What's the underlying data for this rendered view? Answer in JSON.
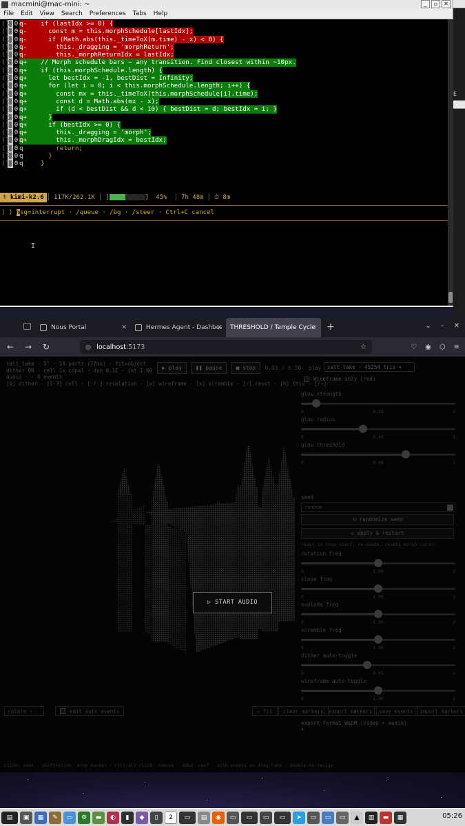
{
  "terminal": {
    "title": "macmini@mac-mini: ~",
    "menu": [
      "File",
      "Edit",
      "View",
      "Search",
      "Preferences",
      "Tabs",
      "Help"
    ],
    "diff": [
      {
        "n": "0",
        "m": "q-",
        "t": "del",
        "c": "  if (lastIdx >= 0) {"
      },
      {
        "n": "0",
        "m": "q-",
        "t": "del",
        "c": "    const m = this.morphSchedule[lastIdx];"
      },
      {
        "n": "0",
        "m": "q-",
        "t": "del",
        "c": "    if (Math.abs(this._timeToX(m.time) - x) < 8) {"
      },
      {
        "n": "0",
        "m": "q-",
        "t": "del",
        "c": "      this._dragging = 'morphReturn';"
      },
      {
        "n": "0",
        "m": "q-",
        "t": "del",
        "c": "      this._morphReturnIdx = lastIdx;"
      },
      {
        "n": "0",
        "m": "q+",
        "t": "add",
        "c": "  // Morph schedule bars — any transition. Find closest within ~10px."
      },
      {
        "n": "0",
        "m": "q+",
        "t": "add",
        "c": "  if (this.morphSchedule.length) {"
      },
      {
        "n": "0",
        "m": "q+",
        "t": "add",
        "c": "    let bestIdx = -1, bestDist = Infinity;"
      },
      {
        "n": "0",
        "m": "q+",
        "t": "add",
        "c": "    for (let i = 0; i < this.morphSchedule.length; i++) {"
      },
      {
        "n": "0",
        "m": "q+",
        "t": "add",
        "c": "      const mx = this._timeToX(this.morphSchedule[i].time);"
      },
      {
        "n": "0",
        "m": "q+",
        "t": "add",
        "c": "      const d = Math.abs(mx - x);"
      },
      {
        "n": "0",
        "m": "q+",
        "t": "add",
        "c": "      if (d < bestDist && d < 10) { bestDist = d; bestIdx = i; }"
      },
      {
        "n": "0",
        "m": "q+",
        "t": "add",
        "c": "    }"
      },
      {
        "n": "0",
        "m": "q+",
        "t": "add",
        "c": "    if (bestIdx >= 0) {"
      },
      {
        "n": "0",
        "m": "q+",
        "t": "add",
        "c": "      this._dragging = 'morph';"
      },
      {
        "n": "0",
        "m": "q+",
        "t": "add",
        "c": "      this._morphDragIdx = bestIdx;"
      },
      {
        "n": "0",
        "m": "q",
        "t": "ctx",
        "c": "      return;"
      },
      {
        "n": "0",
        "m": "q",
        "t": "ctx",
        "c": "    }"
      },
      {
        "n": "0",
        "m": "q",
        "t": "ctx",
        "c": "  }"
      }
    ],
    "gutter_mark": "(`",
    "status": {
      "model": "kimi-k2.6",
      "tokens": "117K/262.1K",
      "progress_text": "45%",
      "progress_fraction": 0.45,
      "elapsed": "7h 48m",
      "timer": "⏱ 8m"
    },
    "prompt_text": "msg=interrupt · /queue · /bg · /steer · Ctrl+C cancel",
    "prompt_glyph": "⟩ ⟩ "
  },
  "browser": {
    "tabs": [
      {
        "label": "Nous Portal",
        "active": false
      },
      {
        "label": "Hermes Agent - Dashboard",
        "active": false
      },
      {
        "label": "THRESHOLD / Temple Cycle",
        "active": true
      }
    ],
    "url_host": "localhost",
    "url_port": ":5173"
  },
  "app": {
    "info_lines": [
      "salt_lake · 5° · 14 parts (77ms) · fit=object",
      "dither ON · cell 1x cdpal · dyn 0.1E · int 1.00",
      "audio · · 0 events",
      "[0] dither · [1-3] cell · [ / ] resolution · [w] wireframe · [s] scramble · [r] reset · [h] this · [/~]"
    ],
    "play_label": "▶ play",
    "pause_label": "❚❚ pause",
    "stop_label": "■ stop",
    "timecode": "0.03 / 6.50",
    "play_select_label": "play",
    "play_select_value": "salt_lake · 45254 tris",
    "wireframe_label": "Wireframe only (red)",
    "sliders_top": [
      {
        "label": "glow strength",
        "value": 0.1,
        "min": "0",
        "mid": "0.10",
        "max": "2"
      },
      {
        "label": "glow radius",
        "value": 0.4,
        "min": "0",
        "mid": "0.40",
        "max": "1"
      },
      {
        "label": "glow threshold",
        "value": 0.68,
        "min": "0",
        "mid": "0.68",
        "max": "1"
      }
    ],
    "seed_heading": "seed",
    "seed_placeholder": "random",
    "randomize_label": "⟲ randomize seed",
    "apply_label": "↻ apply & restart",
    "seed_note": "reset to crop-start, re-seeds, resets morph cursor.",
    "sliders_bottom": [
      {
        "label": "rotation freq",
        "value": 0.5,
        "min": "0",
        "mid": "1.00",
        "max": "2"
      },
      {
        "label": "close freq",
        "value": 0.5,
        "min": "0",
        "mid": "1.00",
        "max": "2"
      },
      {
        "label": "explode freq",
        "value": 0.5,
        "min": "0",
        "mid": "1.00",
        "max": "2"
      },
      {
        "label": "scramble freq",
        "value": 0.5,
        "min": "0",
        "mid": "1.00",
        "max": "2"
      },
      {
        "label": "dither auto-toggle",
        "value": 0.43,
        "min": "0",
        "mid": "0.85",
        "max": "2"
      },
      {
        "label": "wireframe auto-toggle",
        "value": 0.5,
        "min": "0",
        "mid": "1.00",
        "max": "2"
      }
    ],
    "start_audio": "▷ START AUDIO",
    "rotate_label": "rotate",
    "edit_auto_events": "edit auto events",
    "bottom_buttons": [
      "✓ fit",
      "clear markers",
      "export markers",
      "save events",
      "import markers"
    ],
    "export_format": "export format  WebM (video + audio)  ▾",
    "hint": "click: seek · shift+click: drop marker · ctrl/alt click: remove · ddbd: conf · with events on drag-rate · double-to-resize"
  },
  "desktop": {
    "clock": "05:26"
  }
}
